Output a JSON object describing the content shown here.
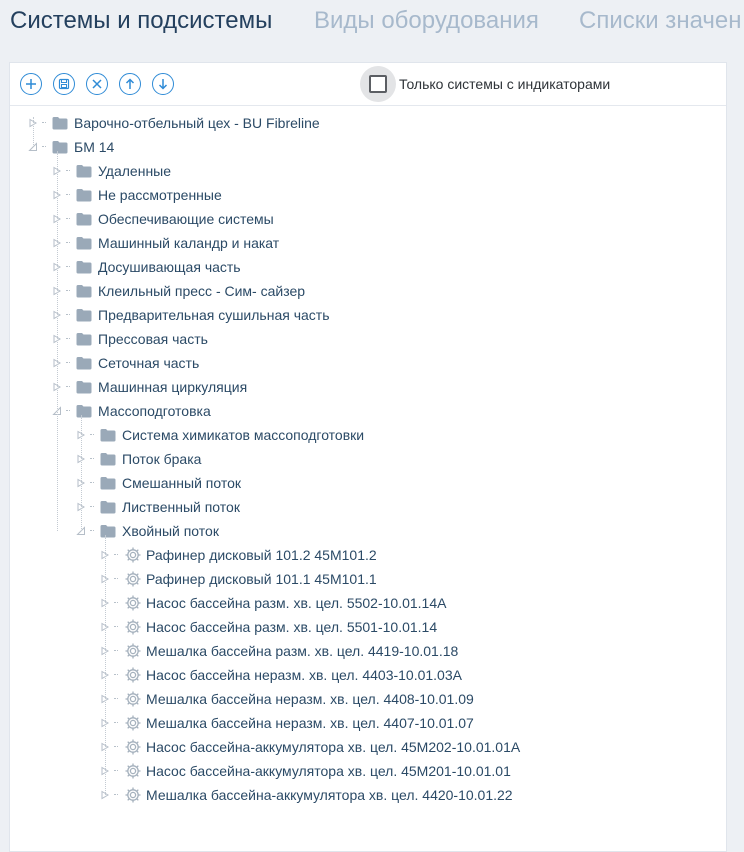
{
  "tabs": [
    {
      "label": "Системы и подсистемы",
      "active": true
    },
    {
      "label": "Виды оборудования",
      "active": false
    },
    {
      "label": "Списки значен",
      "active": false
    }
  ],
  "toolbar": {
    "buttons": [
      {
        "name": "add-button",
        "icon": "plus-icon"
      },
      {
        "name": "save-button",
        "icon": "save-icon"
      },
      {
        "name": "delete-button",
        "icon": "close-icon"
      },
      {
        "name": "move-up-button",
        "icon": "arrow-up-icon"
      },
      {
        "name": "move-down-button",
        "icon": "arrow-down-icon"
      }
    ],
    "filter_checkbox": {
      "label": "Только системы с индикаторами",
      "checked": false
    }
  },
  "tree": [
    {
      "label": "Варочно-отбельный цех - BU Fibreline",
      "level": 0,
      "type": "folder",
      "expanded": false
    },
    {
      "label": "БМ 14",
      "level": 0,
      "type": "folder",
      "expanded": true
    },
    {
      "label": "Удаленные",
      "level": 1,
      "type": "folder",
      "expanded": false
    },
    {
      "label": "Не рассмотренные",
      "level": 1,
      "type": "folder",
      "expanded": false
    },
    {
      "label": "Обеспечивающие системы",
      "level": 1,
      "type": "folder",
      "expanded": false
    },
    {
      "label": "Машинный каландр и накат",
      "level": 1,
      "type": "folder",
      "expanded": false
    },
    {
      "label": "Досушивающая часть",
      "level": 1,
      "type": "folder",
      "expanded": false
    },
    {
      "label": "Клеильный пресс - Сим- сайзер",
      "level": 1,
      "type": "folder",
      "expanded": false
    },
    {
      "label": "Предварительная сушильная часть",
      "level": 1,
      "type": "folder",
      "expanded": false
    },
    {
      "label": "Прессовая часть",
      "level": 1,
      "type": "folder",
      "expanded": false
    },
    {
      "label": "Сеточная часть",
      "level": 1,
      "type": "folder",
      "expanded": false
    },
    {
      "label": "Машинная циркуляция",
      "level": 1,
      "type": "folder",
      "expanded": false
    },
    {
      "label": "Массоподготовка",
      "level": 1,
      "type": "folder",
      "expanded": true
    },
    {
      "label": "Система химикатов массоподготовки",
      "level": 2,
      "type": "folder",
      "expanded": false
    },
    {
      "label": "Поток брака",
      "level": 2,
      "type": "folder",
      "expanded": false
    },
    {
      "label": "Смешанный поток",
      "level": 2,
      "type": "folder",
      "expanded": false
    },
    {
      "label": "Лиственный поток",
      "level": 2,
      "type": "folder",
      "expanded": false
    },
    {
      "label": "Хвойный поток",
      "level": 2,
      "type": "folder",
      "expanded": true
    },
    {
      "label": "Рафинер дисковый 101.2 45M101.2",
      "level": 3,
      "type": "equipment",
      "expanded": false
    },
    {
      "label": "Рафинер дисковый 101.1 45M101.1",
      "level": 3,
      "type": "equipment",
      "expanded": false
    },
    {
      "label": "Насос бассейна разм. хв. цел. 5502-10.01.14A",
      "level": 3,
      "type": "equipment",
      "expanded": false
    },
    {
      "label": "Насос бассейна разм. хв. цел. 5501-10.01.14",
      "level": 3,
      "type": "equipment",
      "expanded": false
    },
    {
      "label": "Мешалка бассейна разм. хв. цел. 4419-10.01.18",
      "level": 3,
      "type": "equipment",
      "expanded": false
    },
    {
      "label": "Насос бассейна неразм. хв. цел. 4403-10.01.03A",
      "level": 3,
      "type": "equipment",
      "expanded": false
    },
    {
      "label": "Мешалка бассейна неразм. хв. цел. 4408-10.01.09",
      "level": 3,
      "type": "equipment",
      "expanded": false
    },
    {
      "label": "Мешалка бассейна неразм. хв. цел. 4407-10.01.07",
      "level": 3,
      "type": "equipment",
      "expanded": false
    },
    {
      "label": "Насос бассейна-аккумулятора хв. цел. 45M202-10.01.01A",
      "level": 3,
      "type": "equipment",
      "expanded": false
    },
    {
      "label": "Насос бассейна-аккумулятора хв. цел. 45M201-10.01.01",
      "level": 3,
      "type": "equipment",
      "expanded": false
    },
    {
      "label": "Мешалка бассейна-аккумулятора хв. цел. 4420-10.01.22",
      "level": 3,
      "type": "equipment",
      "expanded": false
    }
  ],
  "colors": {
    "accent": "#2f8bd6",
    "folder": "#9aa9b8",
    "gear": "#a5b1bd",
    "text": "#2b4a66"
  }
}
